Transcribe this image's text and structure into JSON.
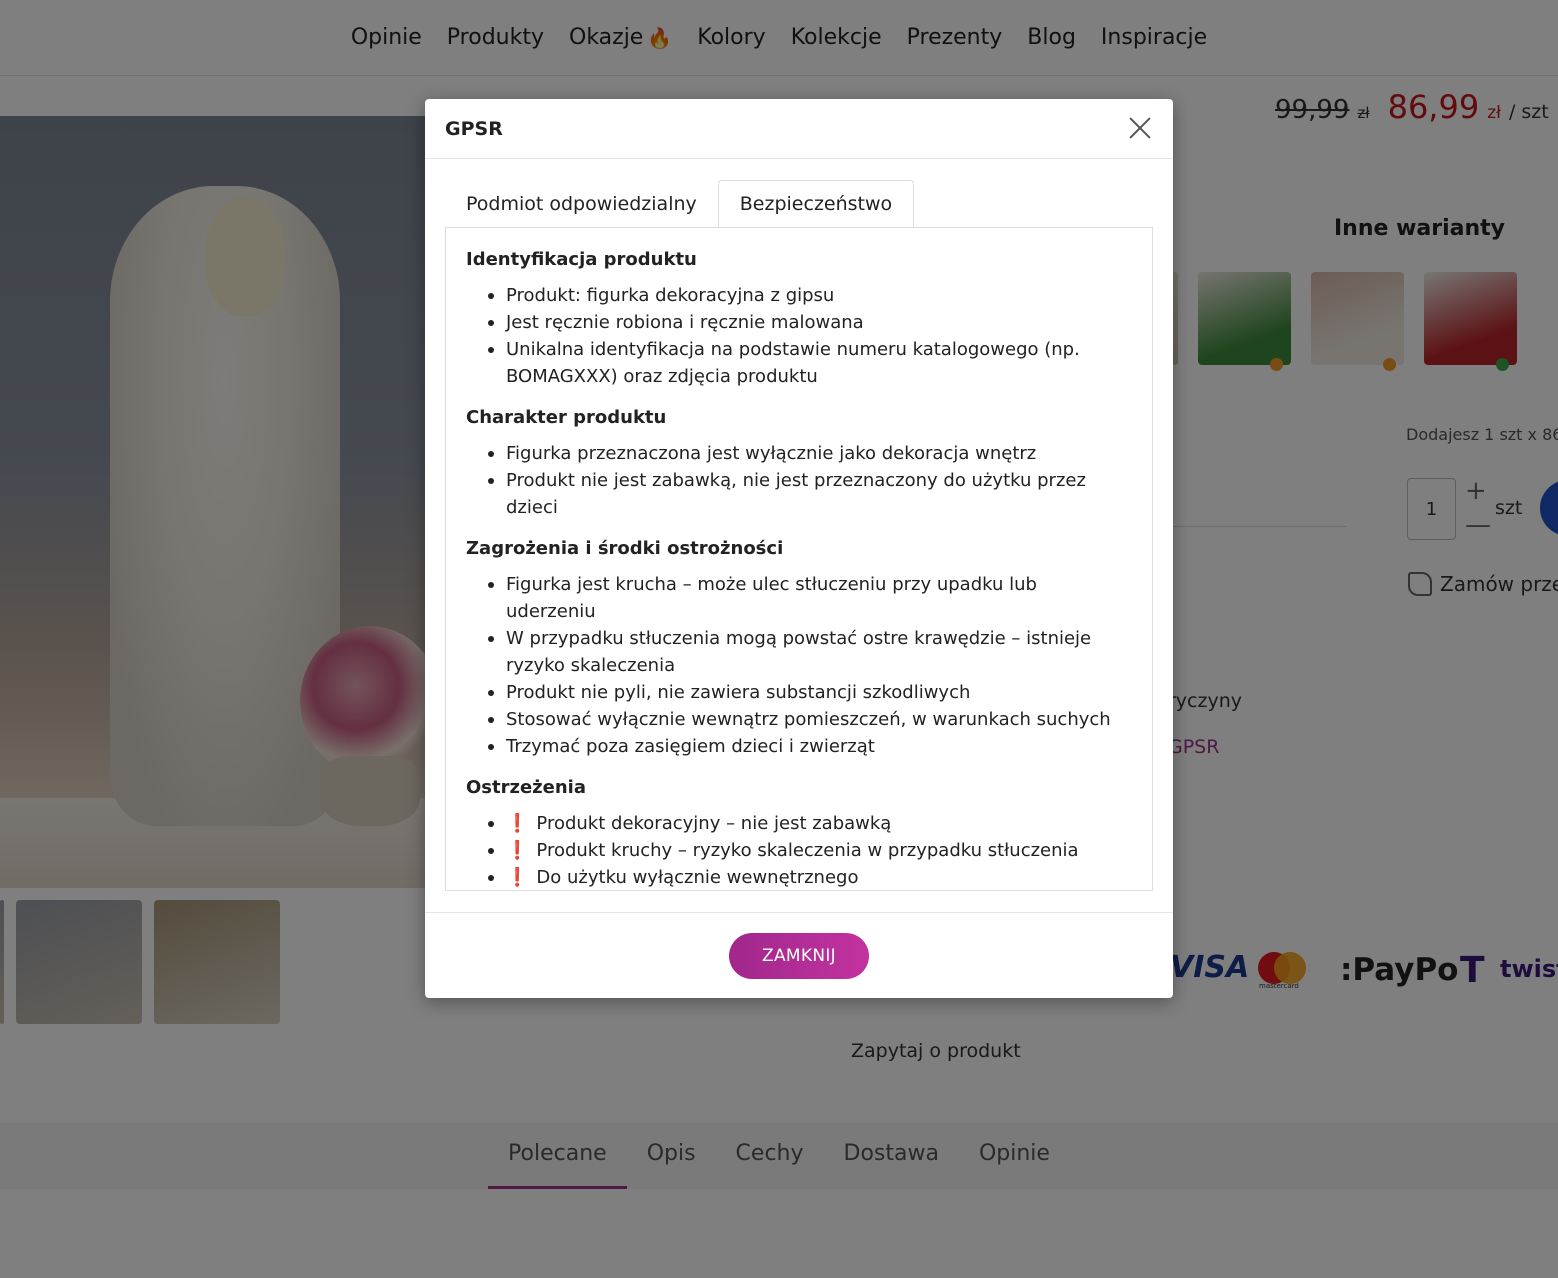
{
  "nav": {
    "items": [
      {
        "label": "Opinie"
      },
      {
        "label": "Produkty"
      },
      {
        "label": "Okazje",
        "icon": "flame-icon"
      },
      {
        "label": "Kolory"
      },
      {
        "label": "Kolekcje"
      },
      {
        "label": "Prezenty"
      },
      {
        "label": "Blog"
      },
      {
        "label": "Inspiracje"
      }
    ]
  },
  "product": {
    "old_price": "99,99",
    "old_currency": "zł",
    "new_price": "86,99",
    "new_currency": "zł",
    "per_unit": "/ szt",
    "variants_title": "Inne warianty",
    "variant_dots": [
      "#f09a2a",
      "#f09a2a",
      "#f09a2a",
      "#3fa64a"
    ],
    "add_info": "Dodajesz 1 szt x 86",
    "quantity": "1",
    "quantity_unit": "szt",
    "qty_plus": "+",
    "qty_minus": "—",
    "phone_order": "Zamów przez",
    "frag1": "ł",
    "frag2": "ryczyny",
    "frag3": "GPSR",
    "ask": "Zapytaj o produkt"
  },
  "payments": {
    "visa": "VISA",
    "mastercard": "mastercard",
    "paypo": ":PayPo",
    "twisto_t": "T",
    "twisto": "twisto"
  },
  "bottom_tabs": [
    {
      "label": "Polecane",
      "active": true
    },
    {
      "label": "Opis",
      "active": false
    },
    {
      "label": "Cechy",
      "active": false
    },
    {
      "label": "Dostawa",
      "active": false
    },
    {
      "label": "Opinie",
      "active": false
    }
  ],
  "modal": {
    "title": "GPSR",
    "tabs": [
      {
        "label": "Podmiot odpowiedzialny",
        "active": false
      },
      {
        "label": "Bezpieczeństwo",
        "active": true
      }
    ],
    "sections": [
      {
        "title": "Identyfikacja produktu",
        "items": [
          "Produkt: figurka dekoracyjna z gipsu",
          "Jest ręcznie robiona i ręcznie malowana",
          "Unikalna identyfikacja na podstawie numeru katalogowego (np. BOMAGXXX) oraz zdjęcia produktu"
        ]
      },
      {
        "title": "Charakter produktu",
        "items": [
          "Figurka przeznaczona jest wyłącznie jako dekoracja wnętrz",
          "Produkt nie jest zabawką, nie jest przeznaczony do użytku przez dzieci"
        ]
      },
      {
        "title": "Zagrożenia i środki ostrożności",
        "items": [
          "Figurka jest krucha – może ulec stłuczeniu przy upadku lub uderzeniu",
          "W przypadku stłuczenia mogą powstać ostre krawędzie – istnieje ryzyko skaleczenia",
          "Produkt nie pyli, nie zawiera substancji szkodliwych",
          "Stosować wyłącznie wewnątrz pomieszczeń, w warunkach suchych",
          "Trzymać poza zasięgiem dzieci i zwierząt"
        ]
      },
      {
        "title": "Ostrzeżenia",
        "warning": true,
        "items": [
          "Produkt dekoracyjny – nie jest zabawką",
          "Produkt kruchy – ryzyko skaleczenia w przypadku stłuczenia",
          "Do użytku wyłącznie wewnętrznego"
        ]
      }
    ],
    "warning_mark": "❗",
    "close_button": "ZAMKNIJ"
  }
}
